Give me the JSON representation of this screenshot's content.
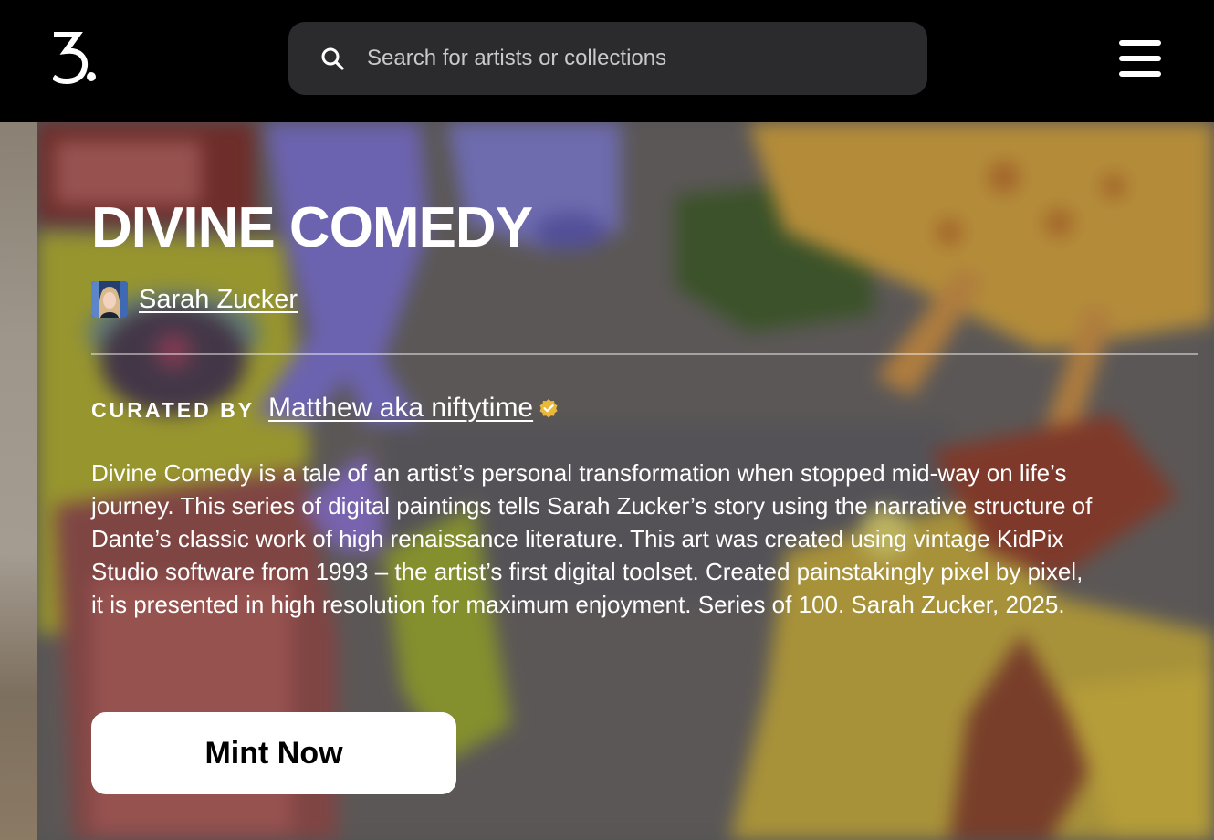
{
  "header": {
    "logo_text": "3.",
    "search": {
      "placeholder": "Search for artists or collections",
      "value": ""
    },
    "menu_icon": "hamburger-menu-icon"
  },
  "hero": {
    "title": "DIVINE COMEDY",
    "artist": {
      "name": "Sarah Zucker"
    },
    "curated_by_label": "CURATED BY",
    "curator": {
      "name": "Matthew aka niftytime",
      "badge_icon": "verified-badge-icon",
      "badge_color": "#e9b93b"
    },
    "description": "Divine Comedy is a tale of an artist’s personal transformation when stopped mid-way on life’s journey. This series of digital paintings tells Sarah Zucker’s story using the narrative structure of Dante’s classic work of high renaissance literature. This art was created using vintage KidPix Studio software from 1993 – the artist’s first digital toolset. Created painstakingly pixel by pixel, it is presented in high resolution for maximum enjoyment. Series of 100. Sarah Zucker, 2025.",
    "cta_label": "Mint Now"
  },
  "colors": {
    "header_bg": "#000000",
    "search_bg": "#2b2b2d",
    "text": "#ffffff",
    "button_bg": "#ffffff",
    "button_text": "#000000"
  }
}
